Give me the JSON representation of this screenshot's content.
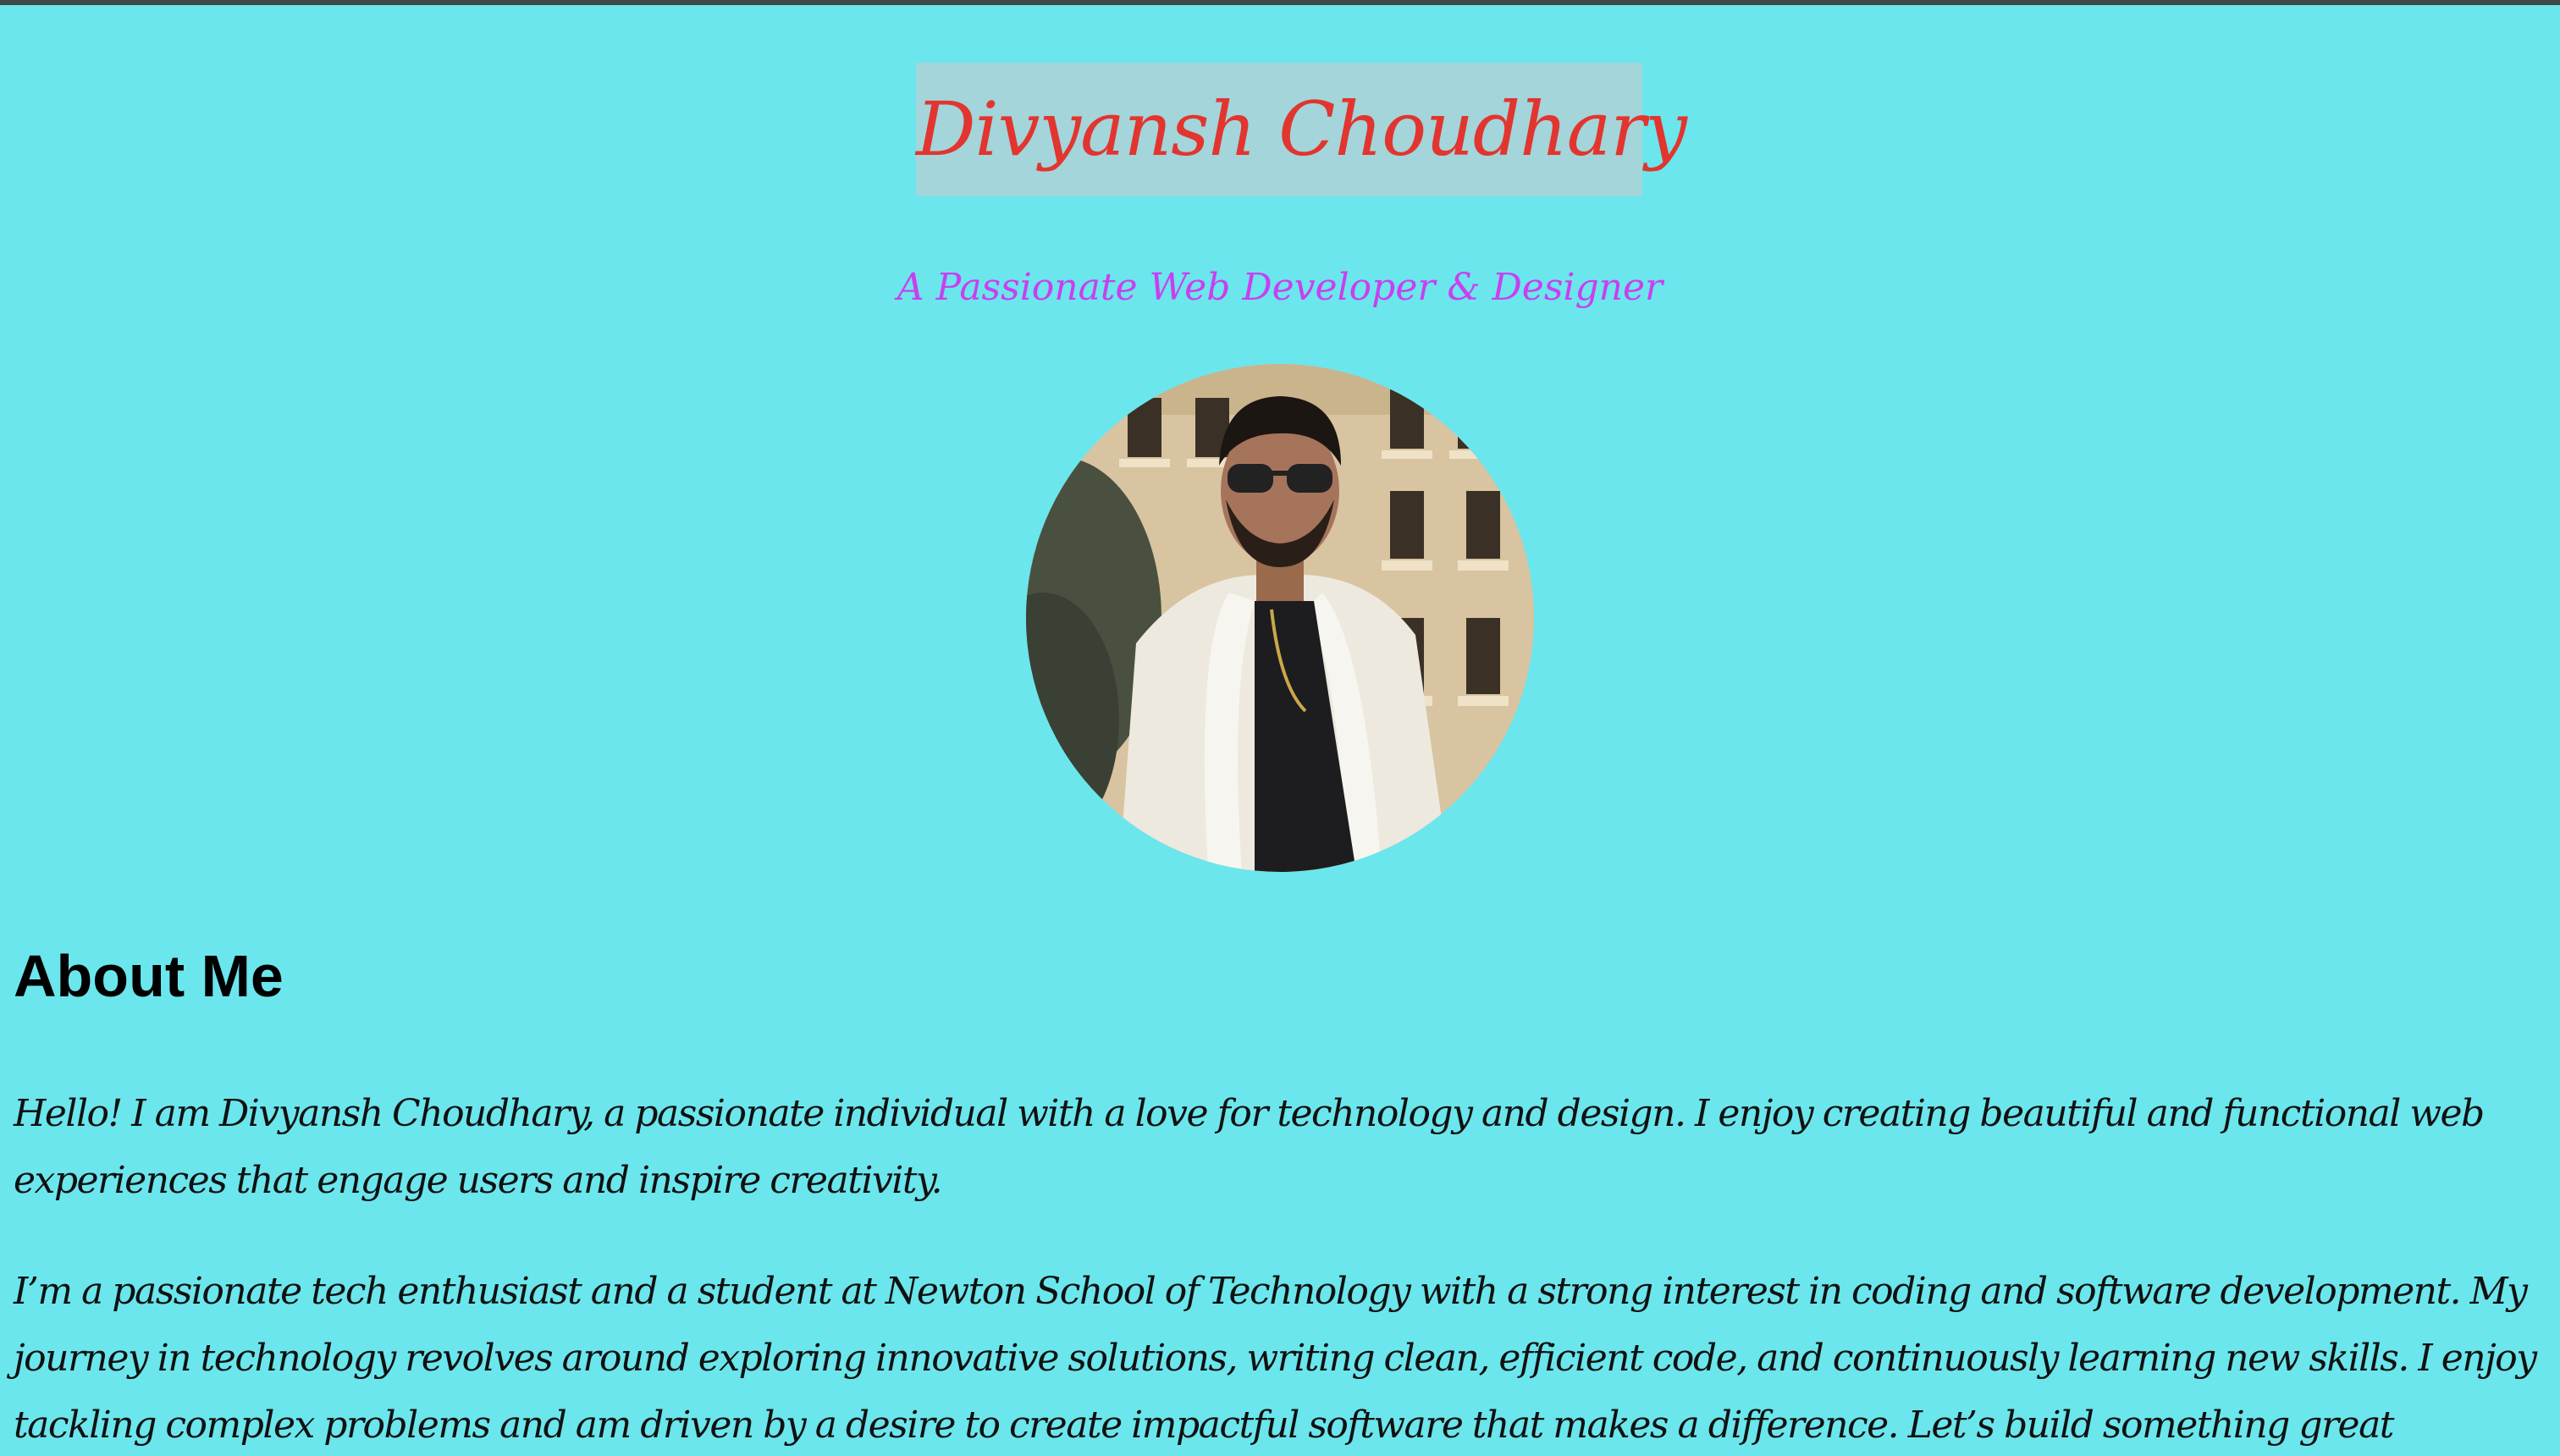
{
  "header": {
    "name": "Divyansh Choudhary",
    "tagline": "A Passionate Web Developer & Designer"
  },
  "profile_photo": {
    "alt": "Divyansh Choudhary"
  },
  "about": {
    "heading": "About Me",
    "paragraphs": [
      "Hello! I am Divyansh Choudhary, a passionate individual with a love for technology and design. I enjoy creating beautiful and functional web experiences that engage users and inspire creativity.",
      "I’m a passionate tech enthusiast and a student at Newton School of Technology with a strong interest in coding and software development. My journey in technology revolves around exploring innovative solutions, writing clean, efficient code, and continuously learning new skills. I enjoy tackling complex problems and am driven by a desire to create impactful software that makes a difference. Let’s build something great together!"
    ]
  },
  "colors": {
    "background": "#6be6ed",
    "title_bg": "#a3d5da",
    "title_text": "#e2352f",
    "tagline_text": "#c93ff0",
    "body_text": "#111111"
  }
}
